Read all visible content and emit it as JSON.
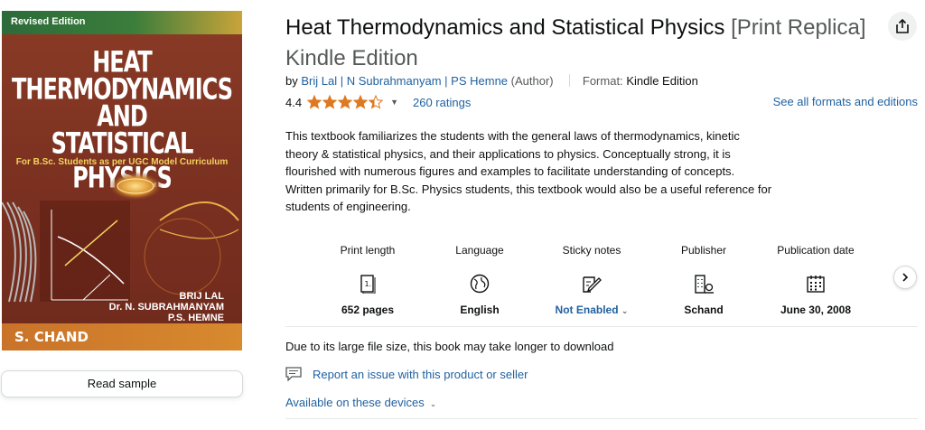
{
  "cover": {
    "edition": "Revised Edition",
    "title_lines": [
      "HEAT",
      "THERMODYNAMICS",
      "AND",
      "STATISTICAL PHYSICS"
    ],
    "subtitle": "For B.Sc. Students as per UGC Model Curriculum",
    "authors": [
      "BRIJ LAL",
      "Dr. N. SUBRAHMANYAM",
      "P.S. HEMNE"
    ],
    "publisher": "S. CHAND"
  },
  "read_sample_label": "Read sample",
  "product": {
    "title": "Heat Thermodynamics and Statistical Physics",
    "title_suffix": "[Print Replica] Kindle Edition",
    "by_label": "by",
    "authors": [
      "Brij Lal",
      "N Subrahmanyam",
      "PS Hemne"
    ],
    "author_separator": "|",
    "author_role": "(Author)",
    "format_label": "Format:",
    "format_value": "Kindle Edition",
    "rating": "4.4",
    "rating_fraction": 0.88,
    "rating_count": "260 ratings",
    "see_all_formats": "See all formats and editions",
    "description": "This textbook familiarizes the students with the general laws of thermodynamics, kinetic theory & statistical physics, and their applications to physics. Conceptually strong, it is flourished with numerous figures and examples to facilitate understanding of concepts. Written primarily for B.Sc. Physics students, this textbook would also be a useful reference for students of engineering."
  },
  "details": [
    {
      "label": "Print length",
      "value": "652 pages",
      "icon": "book-pages-icon"
    },
    {
      "label": "Language",
      "value": "English",
      "icon": "globe-icon"
    },
    {
      "label": "Sticky notes",
      "value": "Not Enabled",
      "icon": "sticky-note-icon"
    },
    {
      "label": "Publisher",
      "value": "Schand",
      "icon": "building-icon"
    },
    {
      "label": "Publication date",
      "value": "June 30, 2008",
      "icon": "calendar-icon"
    }
  ],
  "download_note": "Due to its large file size, this book may take longer to download",
  "report_issue": "Report an issue with this product or seller",
  "available_devices": "Available on these devices",
  "colors": {
    "link": "#2162a1",
    "star": "#de7921",
    "text": "#0f1111"
  }
}
